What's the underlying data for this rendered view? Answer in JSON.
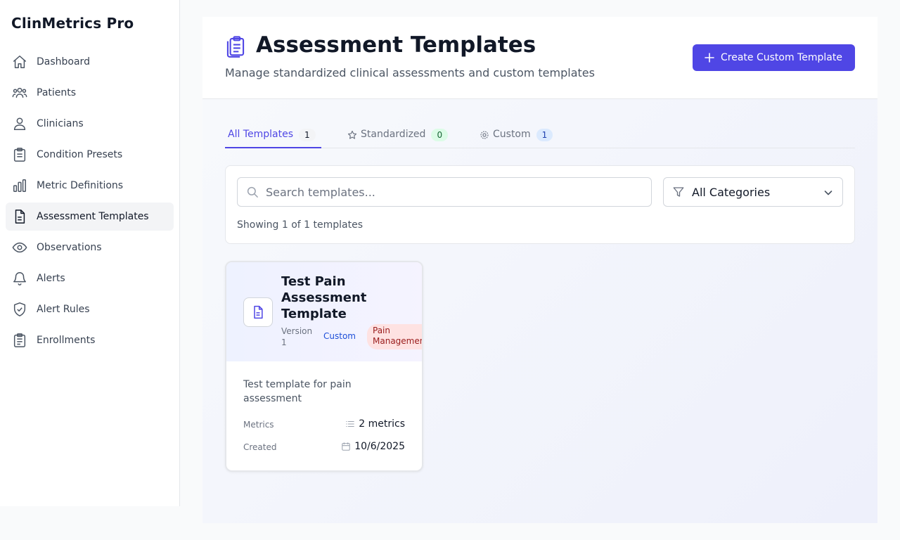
{
  "app": {
    "name": "ClinMetrics Pro"
  },
  "sidebar": {
    "items": [
      {
        "label": "Dashboard",
        "icon": "home-icon"
      },
      {
        "label": "Patients",
        "icon": "users-icon"
      },
      {
        "label": "Clinicians",
        "icon": "user-icon"
      },
      {
        "label": "Condition Presets",
        "icon": "clipboard-icon"
      },
      {
        "label": "Metric Definitions",
        "icon": "bar-chart-icon"
      },
      {
        "label": "Assessment Templates",
        "icon": "document-icon",
        "active": true
      },
      {
        "label": "Observations",
        "icon": "eye-icon"
      },
      {
        "label": "Alerts",
        "icon": "bell-icon"
      },
      {
        "label": "Alert Rules",
        "icon": "shield-check-icon"
      },
      {
        "label": "Enrollments",
        "icon": "clipboard-list-icon"
      }
    ]
  },
  "header": {
    "title": "Assessment Templates",
    "subtitle": "Manage standardized clinical assessments and custom templates",
    "create_label": "Create Custom Template"
  },
  "tabs": [
    {
      "label": "All Templates",
      "count": "1",
      "active": true
    },
    {
      "label": "Standardized",
      "count": "0",
      "icon": "star-icon"
    },
    {
      "label": "Custom",
      "count": "1",
      "icon": "cog-icon"
    }
  ],
  "filters": {
    "search_placeholder": "Search templates...",
    "category": "All Categories",
    "showing": "Showing 1 of 1 templates"
  },
  "templates": [
    {
      "name": "Test Pain Assessment Template",
      "version": "Version 1",
      "type": "Custom",
      "category": "Pain Management",
      "description": "Test template for pain assessment",
      "metrics_label": "Metrics",
      "metrics_value": "2 metrics",
      "created_label": "Created",
      "created_value": "10/6/2025"
    }
  ],
  "colors": {
    "accent": "#4f46e5",
    "tab_all_badge": "#f3f4f6",
    "tab_standardized_badge": "#dcfce7",
    "tab_custom_badge": "#dbeafe",
    "category_badge": "#fee2e2"
  }
}
